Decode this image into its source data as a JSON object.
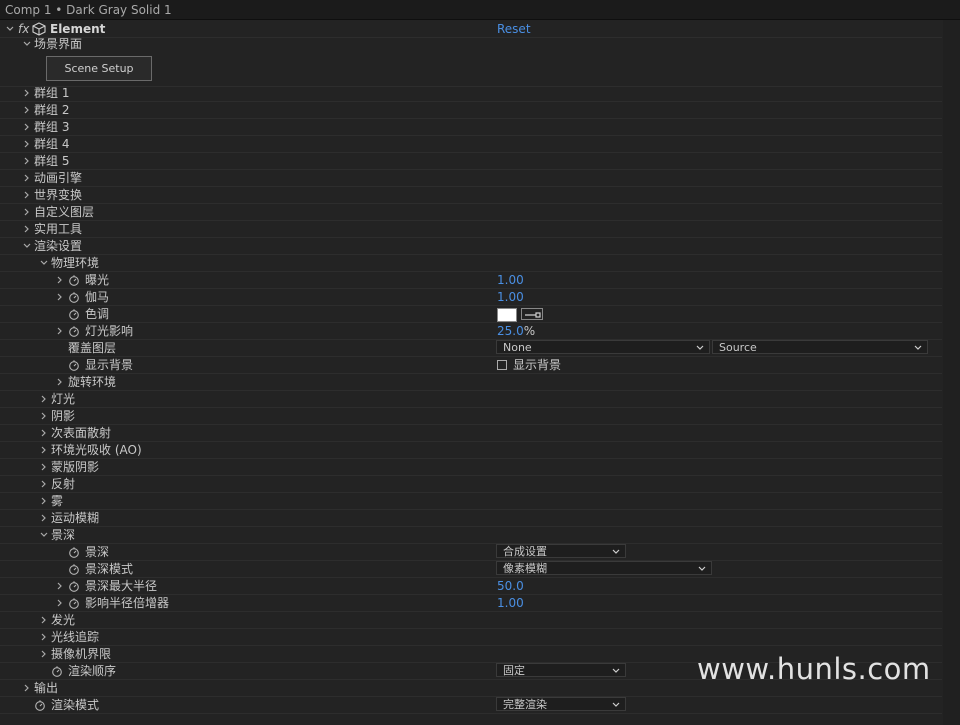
{
  "tab": {
    "label": "Comp 1 • Dark Gray Solid 1"
  },
  "effect": {
    "fx_label": "fx",
    "name": "Element",
    "reset_label": "Reset"
  },
  "scene_section": {
    "label": "场景界面",
    "button_label": "Scene Setup"
  },
  "groups": [
    "群组 1",
    "群组 2",
    "群组 3",
    "群组 4",
    "群组 5"
  ],
  "sections": {
    "animation_engine": "动画引擎",
    "world_transform": "世界变换",
    "custom_layers": "自定义图层",
    "utilities": "实用工具",
    "render_settings": "渲染设置"
  },
  "physical_env": {
    "label": "物理环境",
    "exposure": {
      "label": "曝光",
      "value": "1.00"
    },
    "gamma": {
      "label": "伽马",
      "value": "1.00"
    },
    "tint": {
      "label": "色调",
      "swatch_color": "#ffffff"
    },
    "light_influence": {
      "label": "灯光影响",
      "value": "25.0",
      "unit": "%"
    },
    "override_layer": {
      "label": "覆盖图层",
      "layer_value": "None",
      "source_value": "Source"
    },
    "show_background": {
      "label": "显示背景",
      "checkbox_label": "显示背景",
      "checked": false
    },
    "rotate_env": {
      "label": "旋转环境"
    }
  },
  "render_subsections": {
    "lights": "灯光",
    "shadows": "阴影",
    "subsurface": "次表面散射",
    "ao": "环境光吸收 (AO)",
    "matte_shadow": "蒙版阴影",
    "reflection": "反射",
    "fog": "雾",
    "motion_blur": "运动模糊",
    "dof_section": "景深",
    "glow": "发光",
    "ray_trace": "光线追踪",
    "camera_limits": "摄像机界限"
  },
  "dof": {
    "dof": {
      "label": "景深",
      "value": "合成设置"
    },
    "mode": {
      "label": "景深模式",
      "value": "像素模糊"
    },
    "max_radius": {
      "label": "景深最大半径",
      "value": "50.0"
    },
    "radius_multiplier": {
      "label": "影响半径倍增器",
      "value": "1.00"
    }
  },
  "render_order": {
    "label": "渲染顺序",
    "value": "固定"
  },
  "output": {
    "label": "输出"
  },
  "render_mode": {
    "label": "渲染模式",
    "value": "完整渲染"
  },
  "watermark": {
    "text": "www.hunls.com"
  },
  "colors": {
    "value_blue": "#4a8fe3",
    "panel_bg": "#232323"
  }
}
